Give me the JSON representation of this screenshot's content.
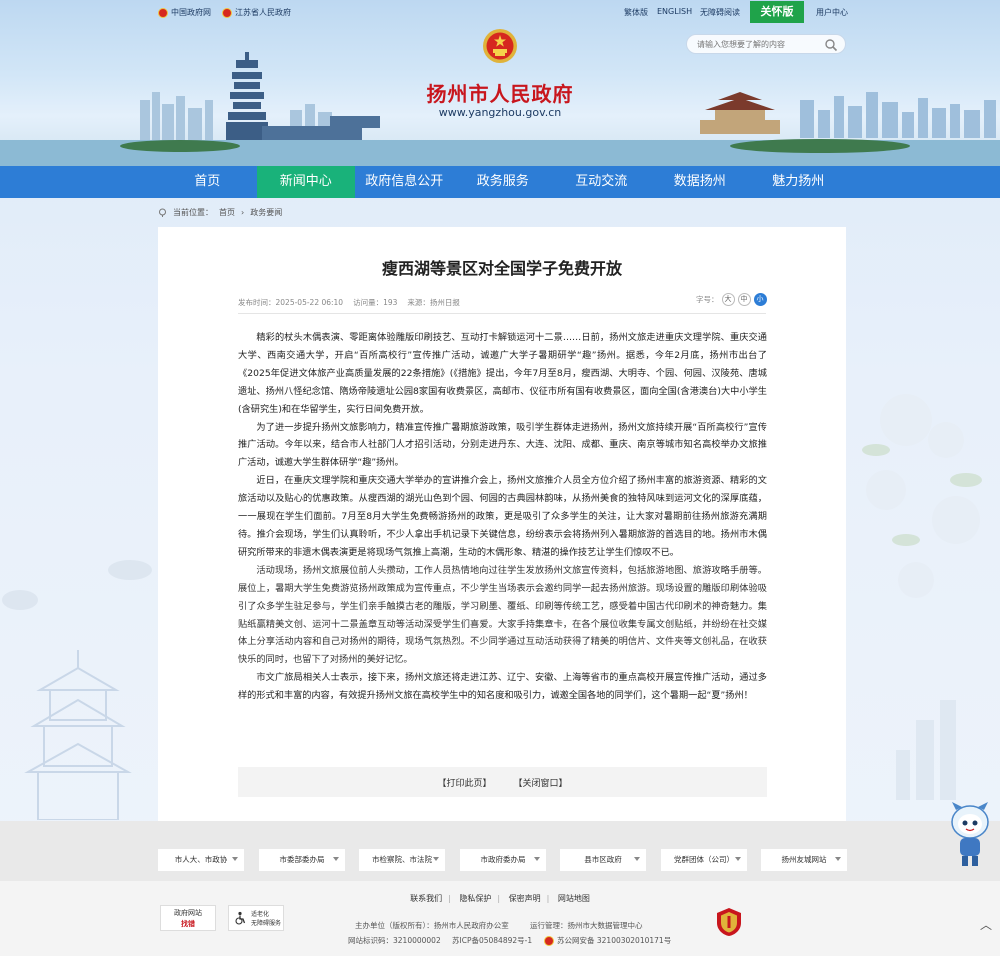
{
  "topbar": {
    "links": [
      "中国政府网",
      "江苏省人民政府"
    ],
    "right_links": [
      "繁体版",
      "ENGLISH",
      "无障碍阅读"
    ],
    "care_label": "关怀版",
    "user_center": "用户中心"
  },
  "search": {
    "placeholder": "请输入您想要了解的内容"
  },
  "site": {
    "title": "扬州市人民政府",
    "url": "www.yangzhou.gov.cn"
  },
  "nav": {
    "items": [
      "首页",
      "新闻中心",
      "政府信息公开",
      "政务服务",
      "互动交流",
      "数据扬州",
      "魅力扬州"
    ],
    "active_index": 1
  },
  "breadcrumb": {
    "label": "当前位置：",
    "items": [
      "首页",
      "政务要闻"
    ]
  },
  "article": {
    "title": "瘦西湖等景区对全国学子免费开放",
    "publish_time": "发布时间：2025-05-22 06:10",
    "views": "访问量：193",
    "source": "来源：扬州日报",
    "fontsize_label": "字号：",
    "fontsize_options": [
      "大",
      "中",
      "小"
    ],
    "paragraphs": [
      "精彩的杖头木偶表演、零距离体验雕版印刷技艺、互动打卡解锁运河十二景……日前，扬州文旅走进重庆文理学院、重庆交通大学、西南交通大学，开启“百所高校行”宣传推广活动，诚邀广大学子暑期研学“趣”扬州。据悉，今年2月底，扬州市出台了《2025年促进文体旅产业高质量发展的22条措施》(《措施》提出，今年7月至8月，瘦西湖、大明寺、个园、何园、汉陵苑、唐城遗址、扬州八怪纪念馆、隋炀帝陵遗址公园8家国有收费景区，高邮市、仪征市所有国有收费景区，面向全国(含港澳台)大中小学生(含研究生)和在华留学生，实行日间免费开放。",
      "为了进一步提升扬州文旅影响力，精准宣传推广暑期旅游政策，吸引学生群体走进扬州，扬州文旅持续开展“百所高校行”宣传推广活动。今年以来，结合市人社部门人才招引活动，分别走进丹东、大连、沈阳、成都、重庆、南京等城市知名高校举办文旅推广活动，诚邀大学生群体研学“趣”扬州。",
      "近日，在重庆文理学院和重庆交通大学举办的宣讲推介会上，扬州文旅推介人员全方位介绍了扬州丰富的旅游资源、精彩的文旅活动以及贴心的优惠政策。从瘦西湖的湖光山色到个园、何园的古典园林韵味，从扬州美食的独特风味到运河文化的深厚底蕴，一一展现在学生们面前。7月至8月大学生免费畅游扬州的政策，更是吸引了众多学生的关注，让大家对暑期前往扬州旅游充满期待。推介会现场，学生们认真聆听，不少人拿出手机记录下关键信息，纷纷表示会将扬州列入暑期旅游的首选目的地。扬州市木偶研究所带来的非遗木偶表演更是将现场气氛推上高潮，生动的木偶形象、精湛的操作技艺让学生们惊叹不已。",
      "活动现场，扬州文旅展位前人头攒动，工作人员热情地向过往学生发放扬州文旅宣传资料，包括旅游地图、旅游攻略手册等。展位上，暑期大学生免费游览扬州政策成为宣传重点，不少学生当场表示会邀约同学一起去扬州旅游。现场设置的雕版印刷体验吸引了众多学生驻足参与，学生们亲手触摸古老的雕版，学习刷墨、覆纸、印刷等传统工艺，感受着中国古代印刷术的神奇魅力。集贴纸赢精美文创、运河十二景盖章互动等活动深受学生们喜爱。大家手持集章卡，在各个展位收集专属文创贴纸，并纷纷在社交媒体上分享活动内容和自己对扬州的期待，现场气氛热烈。不少同学通过互动活动获得了精美的明信片、文件夹等文创礼品，在收获快乐的同时，也留下了对扬州的美好记忆。",
      "市文广旅局相关人士表示，接下来，扬州文旅还将走进江苏、辽宁、安徽、上海等省市的重点高校开展宣传推广活动，通过多样的形式和丰富的内容，有效提升扬州文旅在高校学生中的知名度和吸引力，诚邀全国各地的同学们，这个暑期一起“夏”扬州！"
    ],
    "print_label": "【打印此页】",
    "close_label": "【关闭窗口】"
  },
  "links_bar": {
    "items": [
      "市人大、市政协",
      "市委部委办局",
      "市检察院、市法院",
      "市政府委办局",
      "县市区政府",
      "党群团体（公司）",
      "扬州友城网站"
    ]
  },
  "footer": {
    "links": [
      "联系我们",
      "隐私保护",
      "保密声明",
      "网站地图"
    ],
    "host": "主办单位（版权所有）：扬州市人民政府办公室",
    "operator": "运行管理：扬州市大数据管理中心",
    "site_code": "网站标识码：3210000002",
    "icp": "苏ICP备05084892号-1",
    "police": "苏公网安备 32100302010171号",
    "badge1_line1": "政府网站",
    "badge1_line2": "找错",
    "badge2_line1": "适老化",
    "badge2_line2": "无障碍服务"
  },
  "colors": {
    "nav_bg": "#2d7dd6",
    "nav_active": "#19b27a",
    "title_red": "#c8161d",
    "care_green": "#1fa34a"
  }
}
